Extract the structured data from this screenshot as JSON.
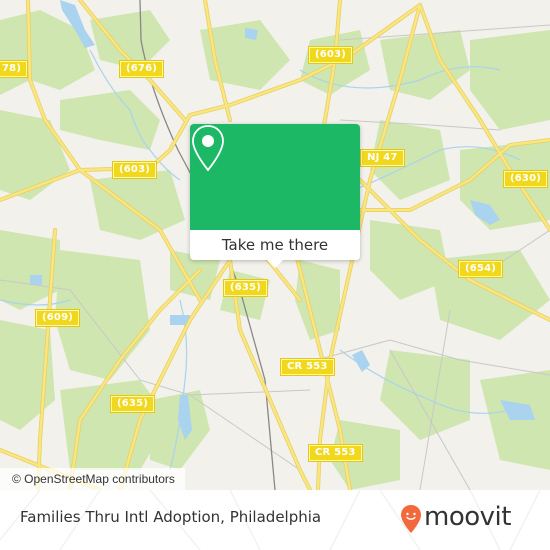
{
  "map": {
    "road_labels": [
      {
        "id": "676",
        "text": "(676)"
      },
      {
        "id": "603-left",
        "text": "(603)"
      },
      {
        "id": "603-top",
        "text": "(603)"
      },
      {
        "id": "nj47",
        "text": "NJ 47"
      },
      {
        "id": "630",
        "text": "(630)"
      },
      {
        "id": "654",
        "text": "(654)"
      },
      {
        "id": "635-center",
        "text": "(635)"
      },
      {
        "id": "609",
        "text": "(609)"
      },
      {
        "id": "635-bottom",
        "text": "(635)"
      },
      {
        "id": "cr553-upper",
        "text": "CR 553"
      },
      {
        "id": "cr553-lower",
        "text": "CR 553"
      },
      {
        "id": "78-partial",
        "text": "78)"
      }
    ],
    "attribution": "© OpenStreetMap contributors",
    "colors": {
      "land": "#f2f1ec",
      "forest": "#cfe6b0",
      "water": "#a9d3ee",
      "road": "#f7e07a",
      "road_label_bg": "#f2d81c"
    }
  },
  "popup": {
    "button_label": "Take me there",
    "icon": "map-pin-icon",
    "color": "#1cb865"
  },
  "footer": {
    "place_name": "Families Thru Intl Adoption, Philadelphia",
    "brand": "moovit",
    "brand_color": "#f26a3c"
  }
}
